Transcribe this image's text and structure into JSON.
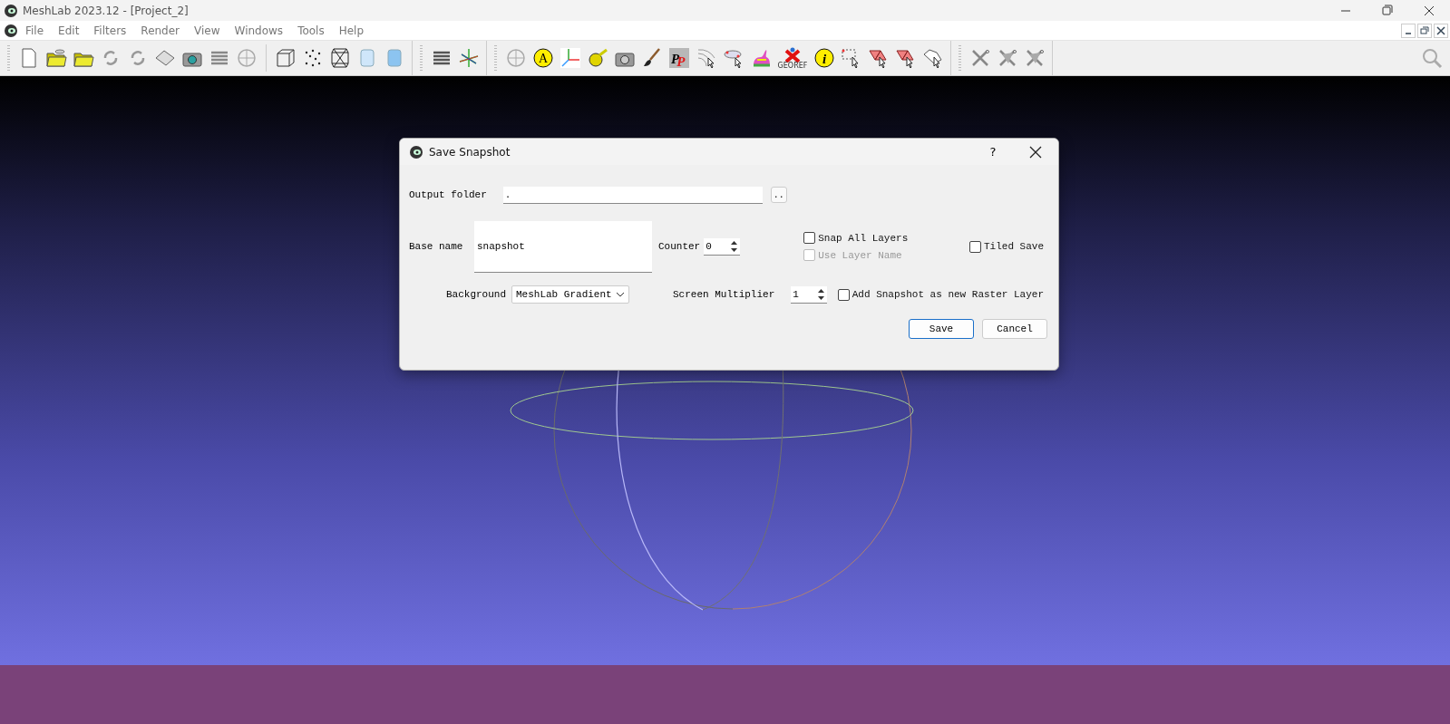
{
  "window": {
    "title": "MeshLab 2023.12 - [Project_2]"
  },
  "menu": [
    "File",
    "Edit",
    "Filters",
    "Render",
    "View",
    "Windows",
    "Tools",
    "Help"
  ],
  "toolbar": {
    "georef_label": "GEOREF",
    "a_label": "A",
    "pp_label": "PP",
    "info_label": "i"
  },
  "dialog": {
    "title": "Save Snapshot",
    "help": "?",
    "output_folder": {
      "label": "Output folder",
      "value": ".",
      "browse": ".."
    },
    "base_name": {
      "label": "Base name",
      "value": "snapshot"
    },
    "counter": {
      "label": "Counter",
      "value": "0"
    },
    "snap_all_layers": {
      "label": "Snap All Layers",
      "checked": false,
      "disabled": false
    },
    "use_layer_name": {
      "label": "Use Layer Name",
      "checked": false,
      "disabled": true
    },
    "tiled_save": {
      "label": "Tiled Save",
      "checked": false,
      "disabled": false
    },
    "background": {
      "label": "Background",
      "value": "MeshLab Gradient"
    },
    "screen_multiplier": {
      "label": "Screen Multiplier",
      "value": "1"
    },
    "add_raster": {
      "label": "Add Snapshot as new Raster Layer",
      "checked": false,
      "disabled": false
    },
    "buttons": [
      {
        "label": "Save",
        "default": true
      },
      {
        "label": "Cancel",
        "default": false
      }
    ]
  }
}
